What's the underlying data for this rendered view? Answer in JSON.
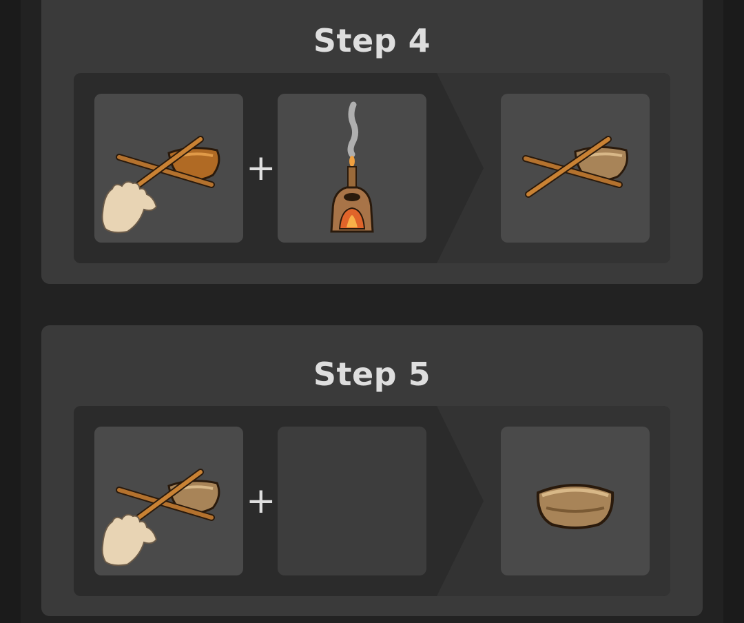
{
  "steps": [
    {
      "title": "Step 4",
      "ingredient_a": {
        "icon": "bowl-drill-hand-icon"
      },
      "ingredient_b": {
        "icon": "kiln-icon"
      },
      "result": {
        "icon": "bowl-drill-icon"
      },
      "plus": "+"
    },
    {
      "title": "Step 5",
      "ingredient_a": {
        "icon": "bowl-drill-hand-icon"
      },
      "ingredient_b": {
        "icon": "empty-slot"
      },
      "result": {
        "icon": "bowl-icon"
      },
      "plus": "+"
    }
  ],
  "colors": {
    "card": "#3a3a3a",
    "slot": "#4a4a4a",
    "wood": "#b4722e",
    "skin": "#e8d4b4"
  }
}
